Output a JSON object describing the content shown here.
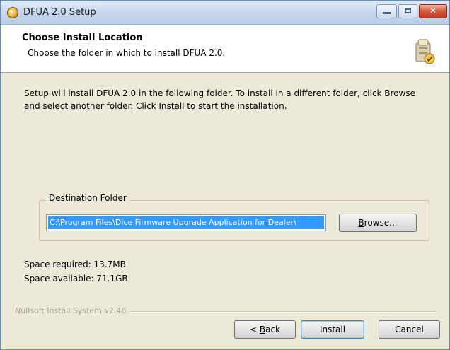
{
  "window": {
    "title": "DFUA 2.0 Setup"
  },
  "header": {
    "title": "Choose Install Location",
    "subtitle": "Choose the folder in which to install DFUA 2.0."
  },
  "body": {
    "intro_line1": "Setup will install DFUA 2.0 in the following folder. To install in a different folder, click Browse",
    "intro_line2": "and select another folder. Click Install to start the installation.",
    "destination_label": "Destination Folder",
    "destination_path": "C:\\Program Files\\Dice Firmware Upgrade Application for Dealer\\",
    "browse_prefix": "",
    "browse_accel": "B",
    "browse_rest": "rowse...",
    "space_required": "Space required: 13.7MB",
    "space_available": "Space available: 71.1GB"
  },
  "footer": {
    "branding": "Nullsoft Install System v2.46",
    "back_prefix": "< ",
    "back_accel": "B",
    "back_rest": "ack",
    "install_label": "Install",
    "cancel_label": "Cancel"
  },
  "colors": {
    "selection": "#3399ff",
    "titlebar": "#c4d6ec",
    "dialog_bg": "#ece9d8"
  }
}
